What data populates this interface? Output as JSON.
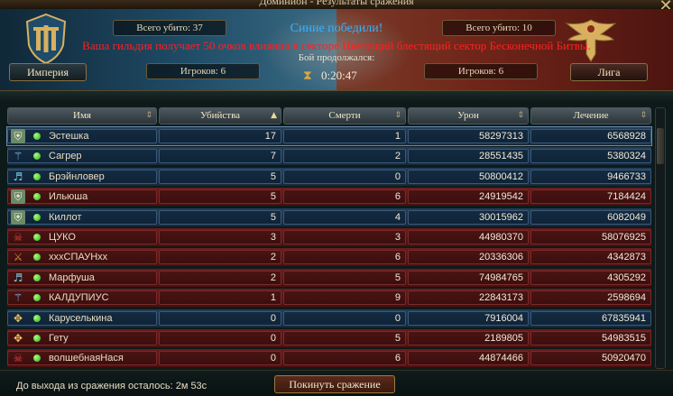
{
  "window": {
    "title": "Доминион - Результаты сражения",
    "close_icon": "close-icon"
  },
  "header": {
    "left_team": {
      "name": "Империя",
      "kills": "Всего убито: 37",
      "players": "Игроков: 6",
      "emblem": "empire-emblem-icon",
      "color": "#1f4b66"
    },
    "right_team": {
      "name": "Лига",
      "kills": "Всего убито: 10",
      "players": "Игроков: 6",
      "emblem": "league-eagle-icon",
      "color": "#6e2418"
    },
    "winner": "Синие победили!",
    "influence": "Ваша гильдия получает 50 очков влияния в секторе Цветущий блестящий сектор Бесконечной Битвы.",
    "status": "Бой продолжался:",
    "duration": "0:20:47"
  },
  "table": {
    "columns": [
      {
        "label": "Имя",
        "sort": "none"
      },
      {
        "label": "Убийства",
        "sort": "desc"
      },
      {
        "label": "Смерти",
        "sort": "none"
      },
      {
        "label": "Урон",
        "sort": "none"
      },
      {
        "label": "Лечение",
        "sort": "none"
      }
    ],
    "rows": [
      {
        "team": "blue",
        "class_icon": "shield-icon",
        "name": "Эстешка",
        "kills": "17",
        "deaths": "1",
        "damage": "58297313",
        "healing": "6568928"
      },
      {
        "team": "blue",
        "class_icon": "staff-icon",
        "name": "Сагрер",
        "kills": "7",
        "deaths": "2",
        "damage": "28551435",
        "healing": "5380324"
      },
      {
        "team": "blue",
        "class_icon": "lute-icon",
        "name": "Брэйнловер",
        "kills": "5",
        "deaths": "0",
        "damage": "50800412",
        "healing": "9466733"
      },
      {
        "team": "red",
        "class_icon": "shield-icon",
        "name": "Ильюша",
        "kills": "5",
        "deaths": "6",
        "damage": "24919542",
        "healing": "7184424"
      },
      {
        "team": "blue",
        "class_icon": "shield-icon",
        "name": "Киллот",
        "kills": "5",
        "deaths": "4",
        "damage": "30015962",
        "healing": "6082049"
      },
      {
        "team": "red",
        "class_icon": "skull-icon",
        "name": "ЦУКО",
        "kills": "3",
        "deaths": "3",
        "damage": "44980370",
        "healing": "58076925"
      },
      {
        "team": "red",
        "class_icon": "dagger-icon",
        "name": "xxxСПАУНxx",
        "kills": "2",
        "deaths": "6",
        "damage": "20336306",
        "healing": "4342873"
      },
      {
        "team": "red",
        "class_icon": "lute-icon",
        "name": "Марфуша",
        "kills": "2",
        "deaths": "5",
        "damage": "74984765",
        "healing": "4305292"
      },
      {
        "team": "red",
        "class_icon": "staff-icon",
        "name": "КАЛДУПИУС",
        "kills": "1",
        "deaths": "9",
        "damage": "22843173",
        "healing": "2598694"
      },
      {
        "team": "blue",
        "class_icon": "cross-icon",
        "name": "Каруселькина",
        "kills": "0",
        "deaths": "0",
        "damage": "7916004",
        "healing": "67835941"
      },
      {
        "team": "red",
        "class_icon": "cross-icon",
        "name": "Гету",
        "kills": "0",
        "deaths": "5",
        "damage": "2189805",
        "healing": "54983515"
      },
      {
        "team": "red",
        "class_icon": "skull-icon",
        "name": "волшебнаяНася",
        "kills": "0",
        "deaths": "6",
        "damage": "44874466",
        "healing": "50920470"
      }
    ]
  },
  "footer": {
    "exit_label": "До выхода из сражения осталось:",
    "exit_time": "2м 53с",
    "leave_button": "Покинуть сражение"
  }
}
